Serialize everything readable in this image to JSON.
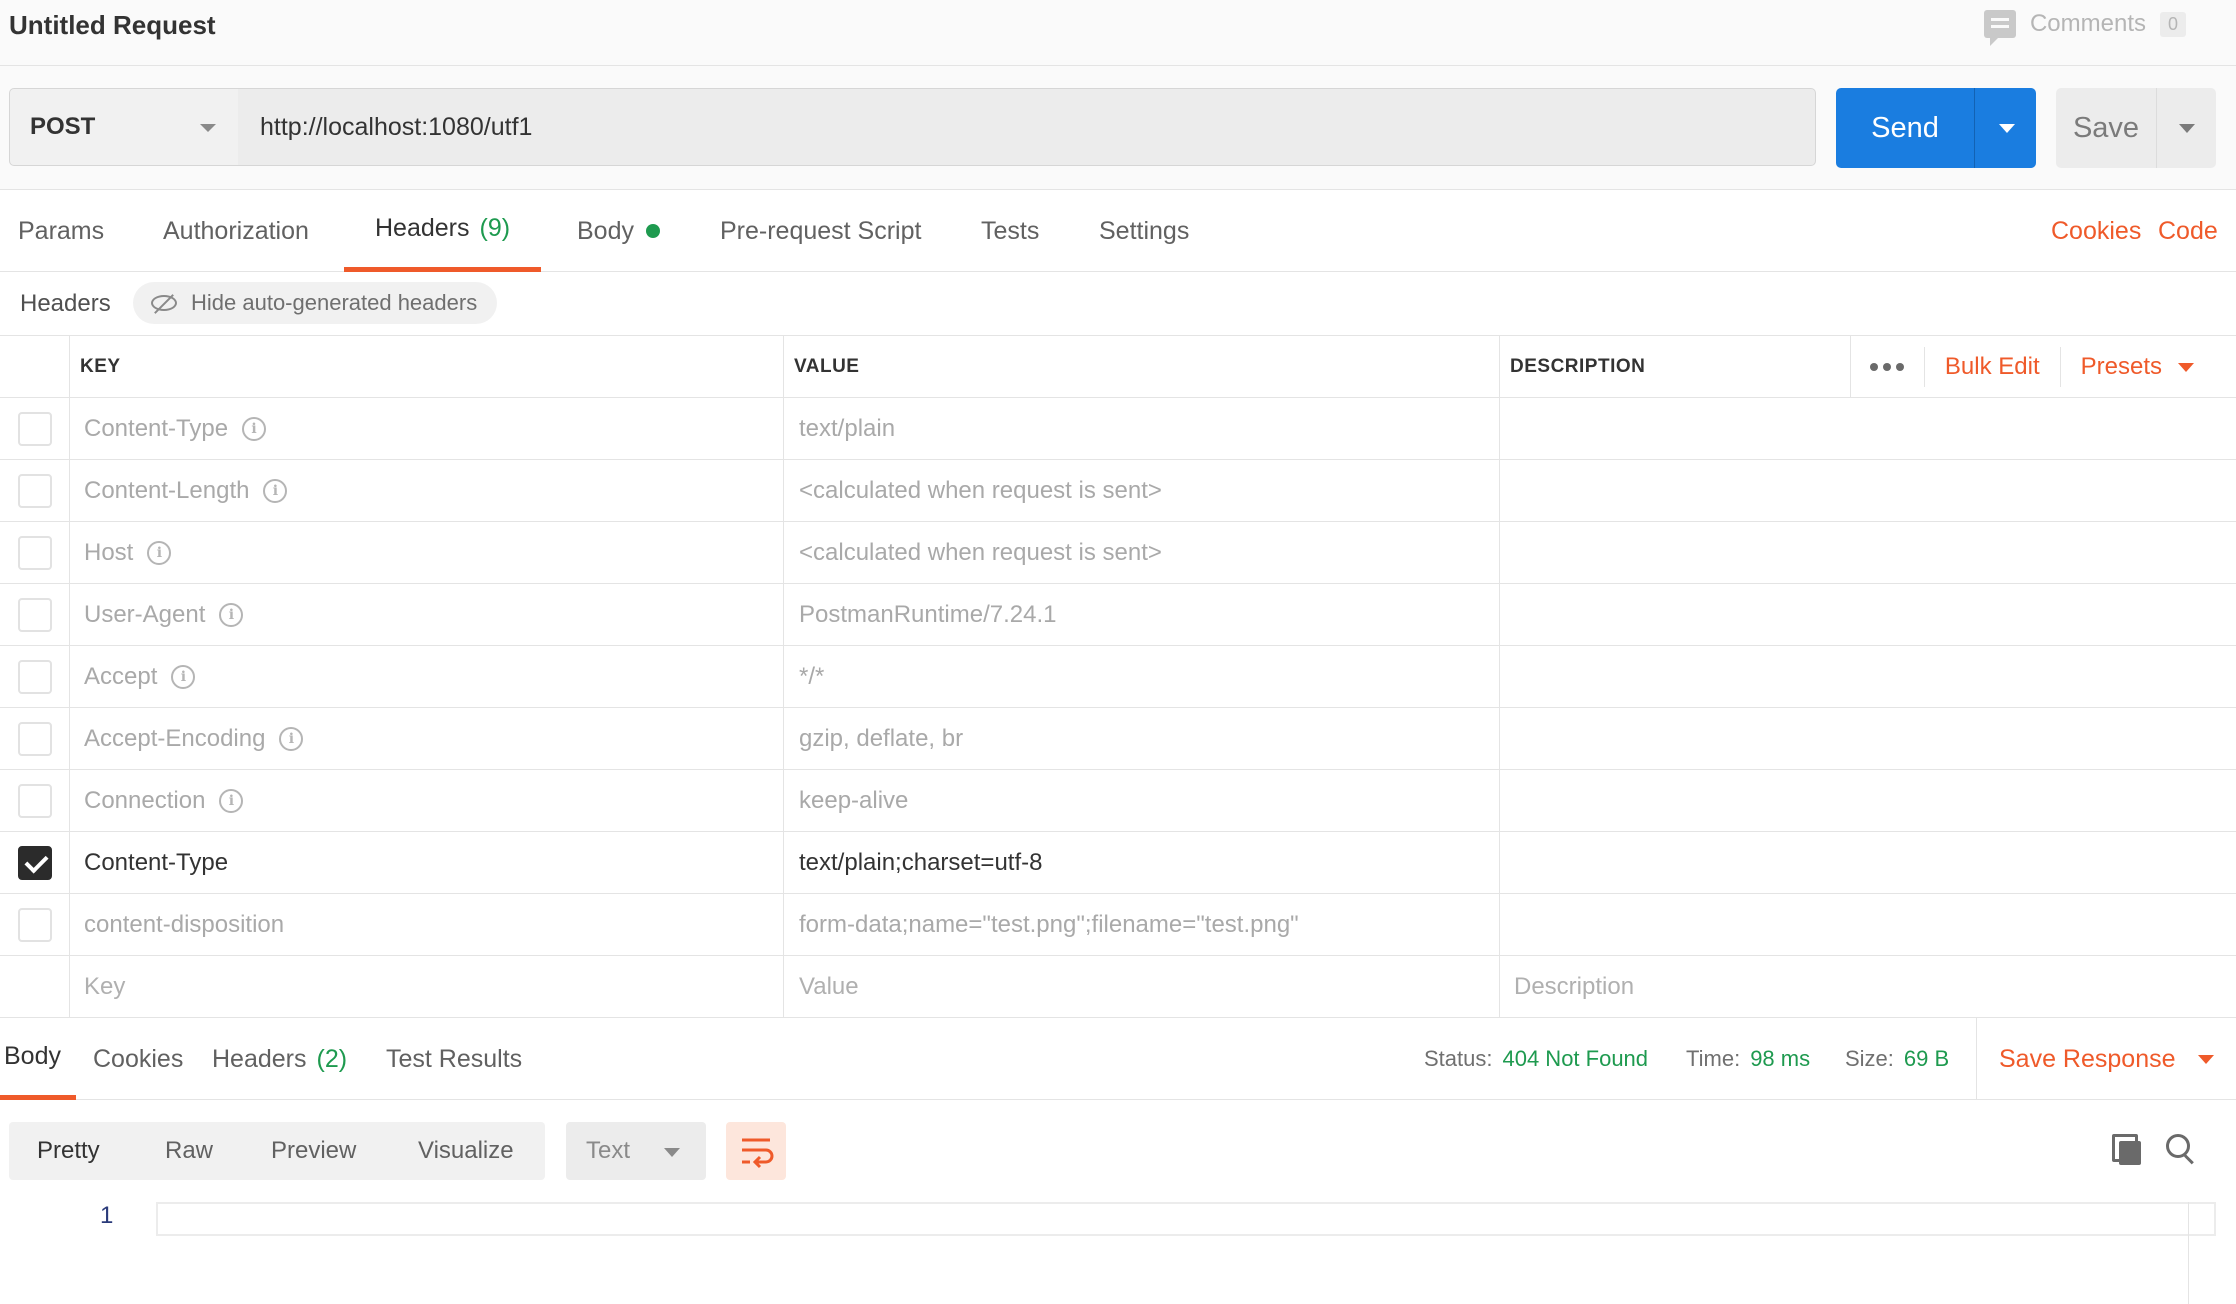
{
  "title": "Untitled Request",
  "comments": {
    "label": "Comments",
    "count": "0"
  },
  "request": {
    "method": "POST",
    "url": "http://localhost:1080/utf1",
    "send_label": "Send",
    "save_label": "Save"
  },
  "tabs": [
    {
      "label": "Params"
    },
    {
      "label": "Authorization"
    },
    {
      "label": "Headers",
      "count": "(9)",
      "active": true
    },
    {
      "label": "Body",
      "has_content": true
    },
    {
      "label": "Pre-request Script"
    },
    {
      "label": "Tests"
    },
    {
      "label": "Settings"
    }
  ],
  "links": {
    "cookies": "Cookies",
    "code": "Code"
  },
  "headers_section": {
    "title": "Headers",
    "hide_auto": "Hide auto-generated headers",
    "columns": {
      "key": "KEY",
      "value": "VALUE",
      "description": "DESCRIPTION"
    },
    "bulk_edit": "Bulk Edit",
    "presets": "Presets",
    "rows": [
      {
        "key": "Content-Type",
        "value": "text/plain",
        "checked": false,
        "info": true
      },
      {
        "key": "Content-Length",
        "value": "<calculated when request is sent>",
        "checked": false,
        "info": true
      },
      {
        "key": "Host",
        "value": "<calculated when request is sent>",
        "checked": false,
        "info": true
      },
      {
        "key": "User-Agent",
        "value": "PostmanRuntime/7.24.1",
        "checked": false,
        "info": true
      },
      {
        "key": "Accept",
        "value": "*/*",
        "checked": false,
        "info": true
      },
      {
        "key": "Accept-Encoding",
        "value": "gzip, deflate, br",
        "checked": false,
        "info": true
      },
      {
        "key": "Connection",
        "value": "keep-alive",
        "checked": false,
        "info": true
      },
      {
        "key": "Content-Type",
        "value": "text/plain;charset=utf-8",
        "checked": true,
        "info": false
      },
      {
        "key": "content-disposition",
        "value": "form-data;name=\"test.png\";filename=\"test.png\"",
        "checked": false,
        "info": false
      }
    ],
    "placeholders": {
      "key": "Key",
      "value": "Value",
      "description": "Description"
    }
  },
  "response": {
    "tabs": [
      {
        "label": "Body",
        "active": true
      },
      {
        "label": "Cookies"
      },
      {
        "label": "Headers",
        "count": "(2)"
      },
      {
        "label": "Test Results"
      }
    ],
    "status_label": "Status:",
    "status_value": "404 Not Found",
    "time_label": "Time:",
    "time_value": "98 ms",
    "size_label": "Size:",
    "size_value": "69 B",
    "save_response": "Save Response",
    "view_modes": [
      "Pretty",
      "Raw",
      "Preview",
      "Visualize"
    ],
    "format": "Text",
    "line_number": "1"
  },
  "colors": {
    "accent": "#ef5a2a",
    "send": "#1a7de0",
    "success": "#1e9a4f"
  }
}
